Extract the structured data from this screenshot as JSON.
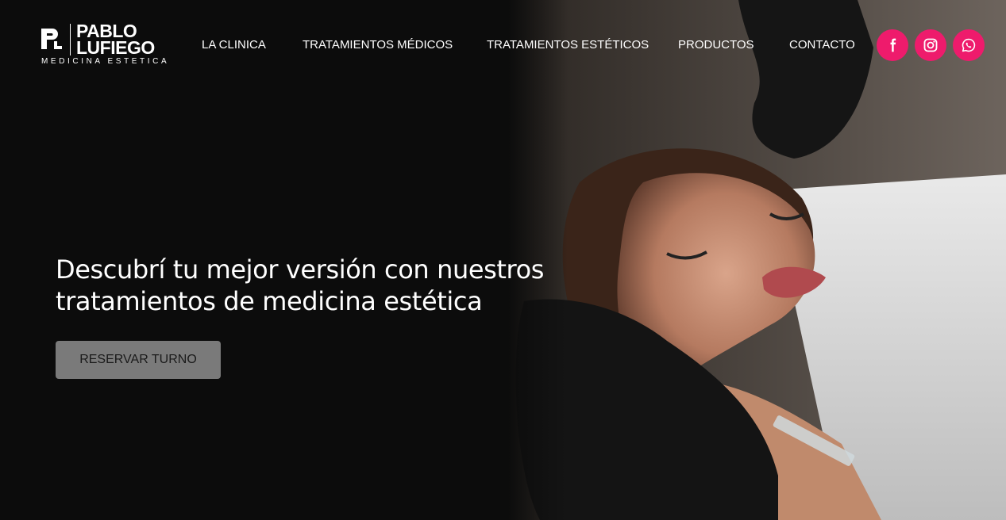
{
  "brand": {
    "name_line1": "PABLO",
    "name_line2": "LUFIEGO",
    "subtitle": "MEDICINA ESTETICA",
    "monogram": "PL"
  },
  "nav": {
    "items": [
      {
        "label": "LA CLINICA"
      },
      {
        "label": "TRATAMIENTOS MÉDICOS"
      },
      {
        "label": "TRATAMIENTOS ESTÉTICOS"
      },
      {
        "label": "PRODUCTOS"
      },
      {
        "label": "CONTACTO"
      }
    ]
  },
  "social": {
    "accent_color": "#ee1b6c",
    "icons": [
      "facebook-icon",
      "instagram-icon",
      "whatsapp-icon"
    ]
  },
  "hero": {
    "headline_line1": "Descubrí tu mejor versión con nuestros",
    "headline_line2": "tratamientos de medicina estética",
    "cta_label": "RESERVAR TURNO",
    "image": "woman receiving aesthetic injection treatment"
  }
}
